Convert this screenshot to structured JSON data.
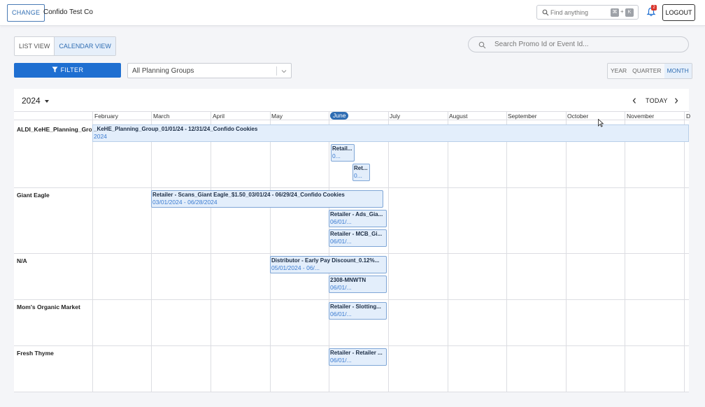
{
  "header": {
    "change_label": "CHANGE",
    "company": "Confido Test Co",
    "find_placeholder": "Find anything",
    "shortcut_key1": "⌘",
    "shortcut_plus": "+",
    "shortcut_key2": "K",
    "notification_count": "2",
    "logout_label": "LOGOUT"
  },
  "views": {
    "list": "LIST VIEW",
    "calendar": "CALENDAR VIEW",
    "active": "calendar"
  },
  "search": {
    "placeholder": "Search Promo Id or Event Id..."
  },
  "filter": {
    "label": "FILTER"
  },
  "planning_groups": {
    "value": "All Planning Groups"
  },
  "period": {
    "year": "YEAR",
    "quarter": "QUARTER",
    "month": "MONTH",
    "active": "month"
  },
  "calendar": {
    "year": "2024",
    "today_label": "TODAY",
    "months": [
      "February",
      "March",
      "April",
      "May",
      "June",
      "July",
      "August",
      "September",
      "October",
      "November",
      "D"
    ],
    "current_month": "June",
    "groups": [
      {
        "name": "ALDI_KeHE_Planning_Group"
      },
      {
        "name": "Giant Eagle"
      },
      {
        "name": "N/A"
      },
      {
        "name": "Mom's Organic Market"
      },
      {
        "name": "Fresh Thyme"
      }
    ],
    "events": [
      {
        "title": "_KeHE_Planning_Group_01/01/24 - 12/31/24_Confido Cookies",
        "dates": "2024"
      },
      {
        "title": "Retail...",
        "dates": "0..."
      },
      {
        "title": "Ret...",
        "dates": "0..."
      },
      {
        "title": "Retailer - Scans_Giant Eagle_$1.50_03/01/24 - 06/29/24_Confido Cookies",
        "dates": "03/01/2024 - 06/28/2024"
      },
      {
        "title": "Retailer - Ads_Gia...",
        "dates": "06/01/..."
      },
      {
        "title": "Retailer - MCB_Gi...",
        "dates": "06/01/..."
      },
      {
        "title": "Distributor - Early Pay Discount_0.12%...",
        "dates": "05/01/2024 - 06/..."
      },
      {
        "title": "2308-MNWTN",
        "dates": "06/01/..."
      },
      {
        "title": "Retailer - Slotting...",
        "dates": "06/01/..."
      },
      {
        "title": "Retailer - Retailer ...",
        "dates": "06/01/..."
      }
    ]
  },
  "colors": {
    "accent": "#1f6fd1",
    "event_fill": "#e3eefb",
    "event_border": "#7fa6d6",
    "date_text": "#3b7bd0"
  }
}
